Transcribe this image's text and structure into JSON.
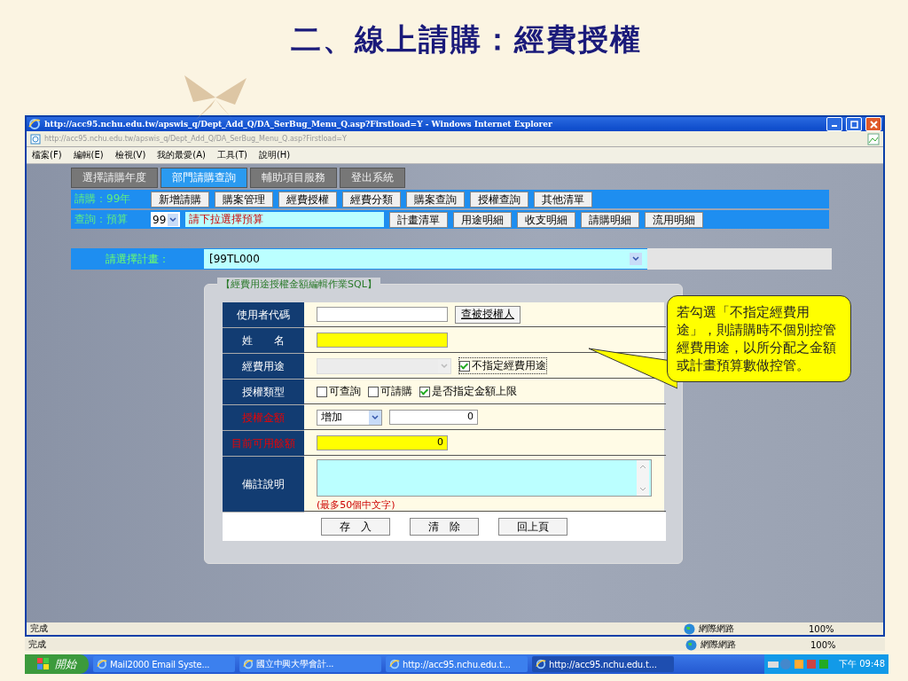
{
  "slide_title": "二、線上請購：經費授權",
  "browser": {
    "title": "http://acc95.nchu.edu.tw/apswis_q/Dept_Add_Q/DA_SerBug_Menu_Q.asp?Firstload=Y - Windows Internet Explorer",
    "address": "http://acc95.nchu.edu.tw/apswis_q/Dept_Add_Q/DA_SerBug_Menu_Q.asp?Firstload=Y",
    "menu": [
      "檔案(F)",
      "編輯(E)",
      "檢視(V)",
      "我的最愛(A)",
      "工具(T)",
      "說明(H)"
    ],
    "status": "完成",
    "zone": "網際網路",
    "zoom": "100%"
  },
  "tabs": [
    {
      "label": "選擇請購年度",
      "selected": false
    },
    {
      "label": "部門請購查詢",
      "selected": true
    },
    {
      "label": "輔助項目服務",
      "selected": false
    },
    {
      "label": "登出系統",
      "selected": false
    }
  ],
  "purchase_row": {
    "label": "請購：99年",
    "buttons": [
      "新增請購",
      "購案管理",
      "經費授權",
      "經費分類",
      "購案查詢",
      "授權查詢",
      "其他清單"
    ]
  },
  "query_row": {
    "label": "查詢：預算",
    "year": "99",
    "hint": "請下拉選擇預算",
    "buttons": [
      "計畫清單",
      "用途明細",
      "收支明細",
      "請購明細",
      "流用明細"
    ]
  },
  "plan": {
    "label": "請選擇計畫：",
    "value": "[99TL000"
  },
  "form": {
    "legend": "【經費用途授權金額編輯作業SQL】",
    "rows": [
      {
        "kind": "input_button",
        "label": "使用者代碼",
        "warning": false,
        "readonly": false,
        "button": "查被授權人"
      },
      {
        "kind": "input",
        "label": "姓　　名",
        "warning": false,
        "readonly": true
      },
      {
        "kind": "select_check",
        "label": "經費用途",
        "warning": false,
        "disabled": true,
        "check": {
          "label": "不指定經費用途",
          "checked": true
        }
      },
      {
        "kind": "checks",
        "label": "授權類型",
        "warning": false,
        "checks": [
          {
            "label": "可查詢",
            "checked": false
          },
          {
            "label": "可請購",
            "checked": false
          },
          {
            "label": "是否指定金額上限",
            "checked": true
          }
        ]
      },
      {
        "kind": "select_input",
        "label": "授權金額",
        "warning": true,
        "select": "增加",
        "value": "0"
      },
      {
        "kind": "input",
        "label": "目前可用餘額",
        "warning": true,
        "readonly": true,
        "value": "0"
      },
      {
        "kind": "textarea",
        "label": "備註說明",
        "warning": false,
        "note": "(最多50個中文字)"
      }
    ],
    "buttons": [
      "存　入",
      "清　除",
      "回上頁"
    ]
  },
  "callout": "若勾選「不指定經費用途」，則請購時不個別控管經費用途，以所分配之金額或計畫預算數做控管。",
  "lower_status": {
    "status": "完成",
    "zone": "網際網路",
    "zoom": "100%"
  },
  "taskbar": {
    "start": "開始",
    "tasks": [
      {
        "label": "Mail2000 Email Syste...",
        "selected": false
      },
      {
        "label": "國立中興大學會計...",
        "selected": false
      },
      {
        "label": "http://acc95.nchu.edu.t...",
        "selected": false
      },
      {
        "label": "http://acc95.nchu.edu.t...",
        "selected": true
      }
    ],
    "clock": "下午 09:48"
  }
}
